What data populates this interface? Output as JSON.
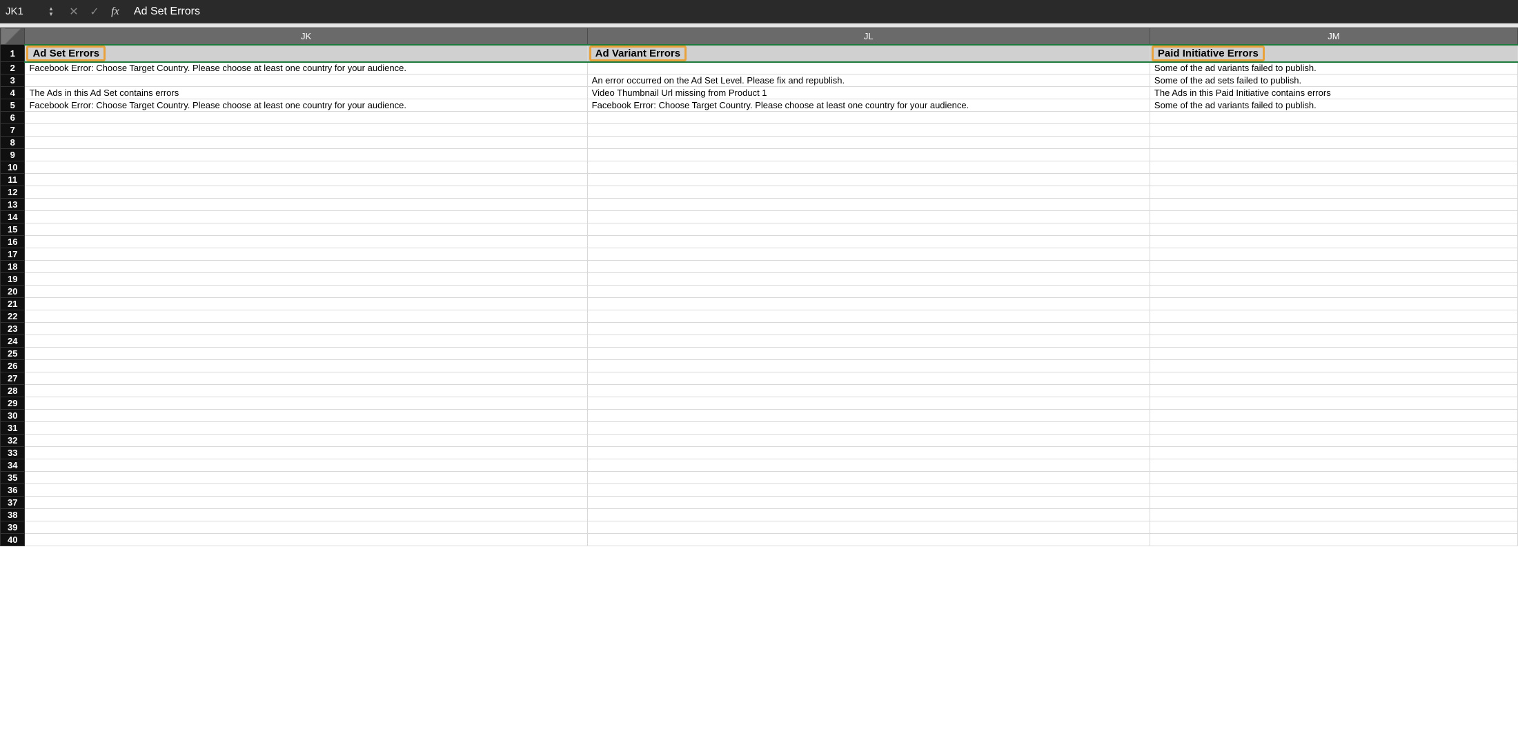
{
  "formula_bar": {
    "cell_ref": "JK1",
    "content": "Ad Set Errors"
  },
  "columns": [
    "JK",
    "JL",
    "JM"
  ],
  "row_count": 40,
  "header_row": {
    "jk": "Ad Set Errors",
    "jl": "Ad Variant Errors",
    "jm": "Paid Initiative Errors"
  },
  "rows": {
    "2": {
      "jk": "Facebook Error: Choose Target Country. Please choose at least one country for your audience.",
      "jl": "",
      "jm": "Some of the ad variants failed to publish."
    },
    "3": {
      "jk": "",
      "jl": "An error occurred on the Ad Set Level. Please fix and republish.",
      "jm": "Some of the ad sets failed to publish."
    },
    "4": {
      "jk": "The Ads in this Ad Set contains errors",
      "jl": "Video Thumbnail Url missing from Product 1",
      "jm": "The Ads in this Paid Initiative contains errors"
    },
    "5": {
      "jk": "Facebook Error: Choose Target Country. Please choose at least one country for your audience.",
      "jl": "Facebook Error: Choose Target Country. Please choose at least one country for your audience.",
      "jm": "Some of the ad variants failed to publish."
    }
  }
}
